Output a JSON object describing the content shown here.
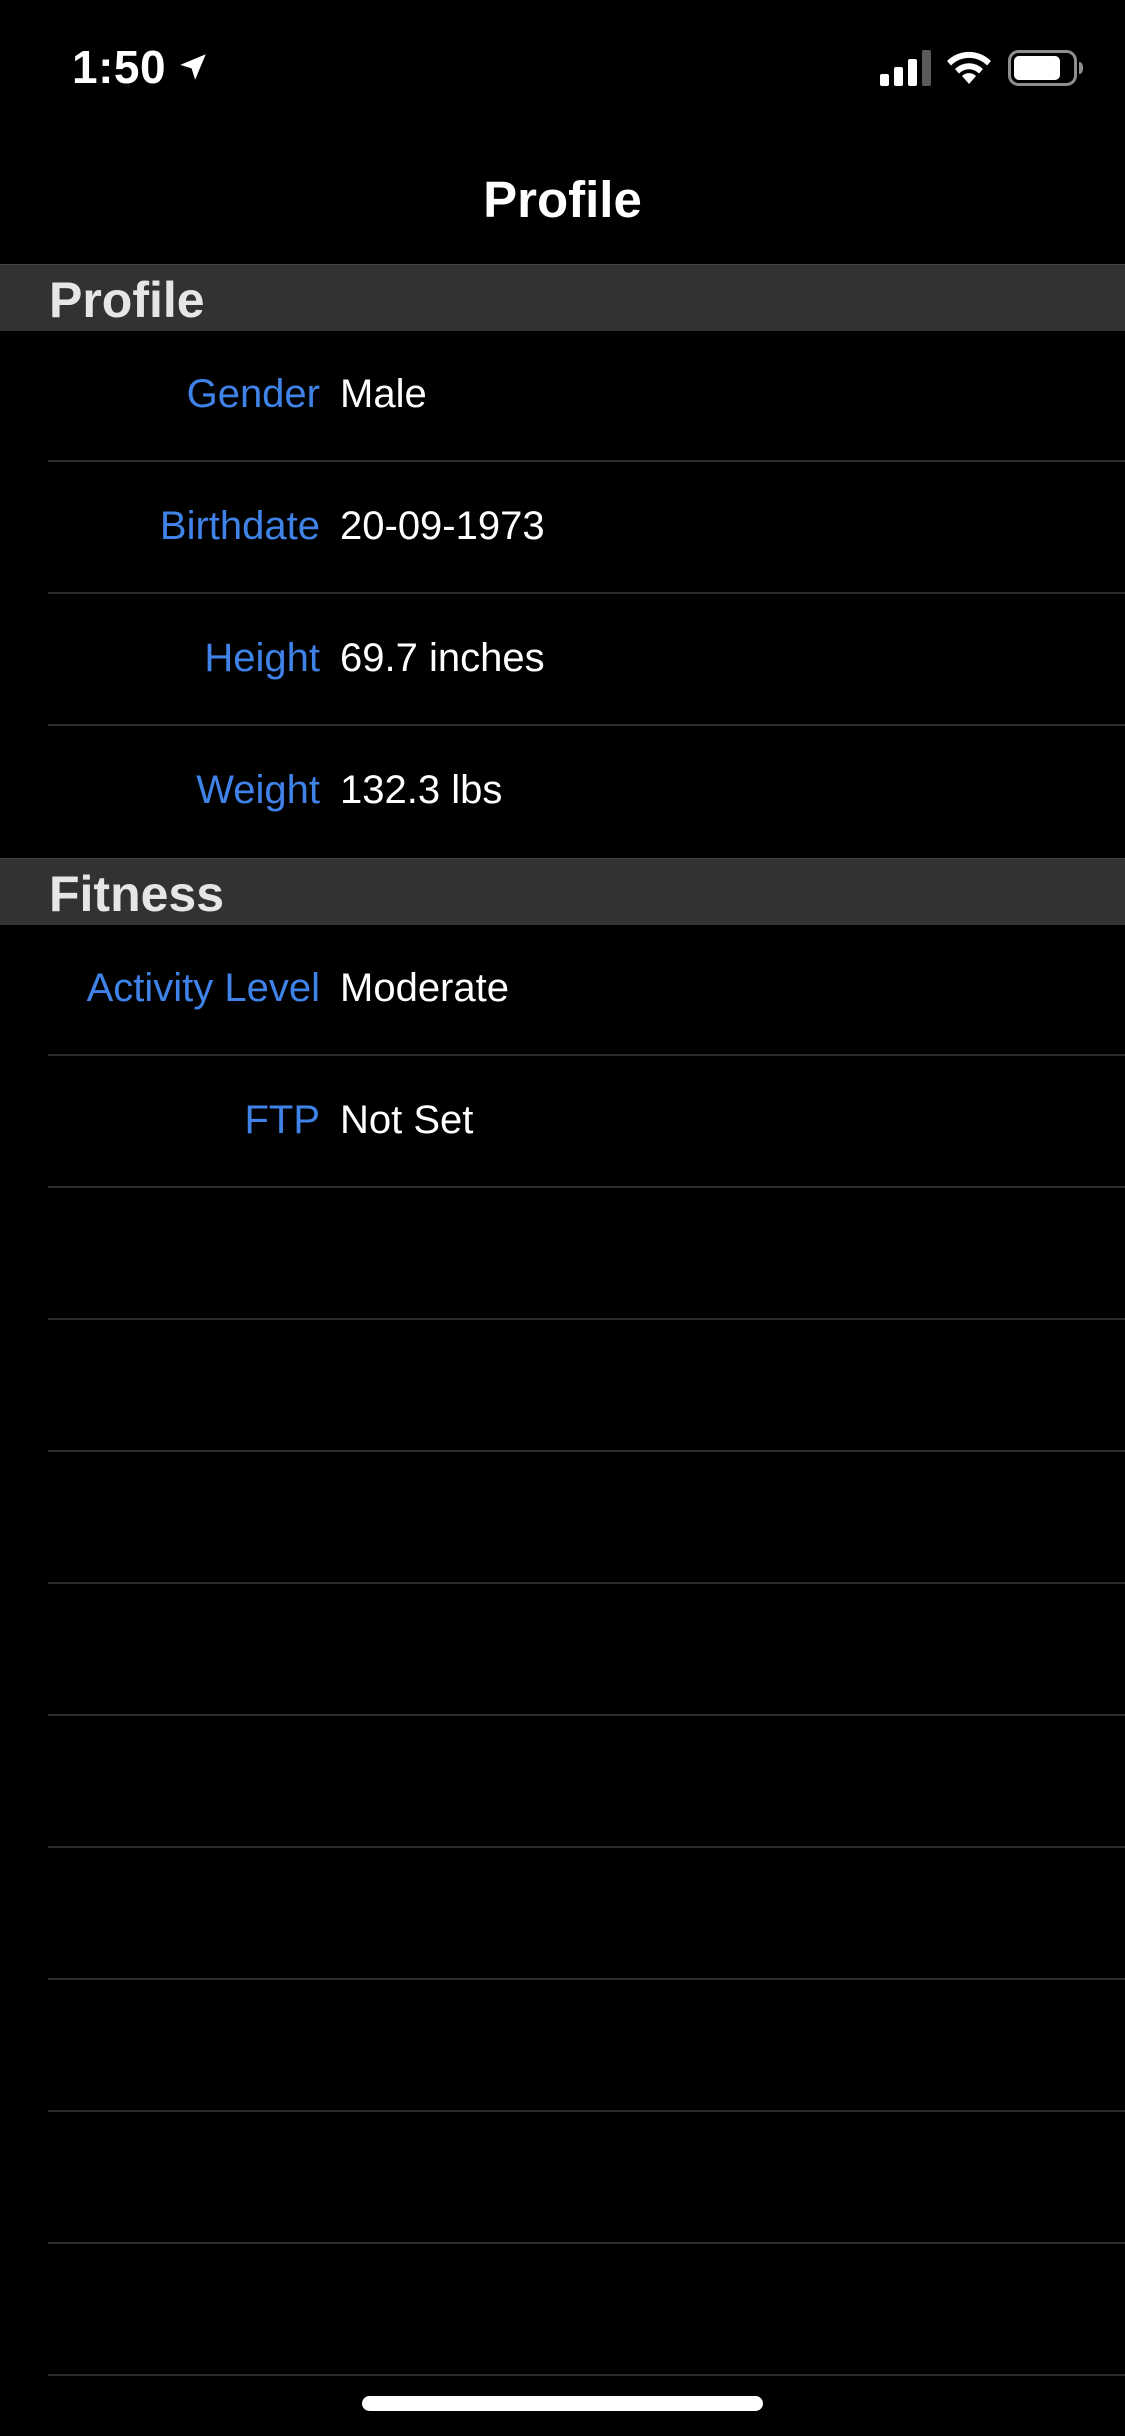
{
  "status_bar": {
    "time": "1:50",
    "icons": [
      "location-arrow-icon",
      "cellular-signal-icon",
      "wifi-icon",
      "battery-icon"
    ]
  },
  "nav": {
    "title": "Profile"
  },
  "sections": {
    "profile": {
      "title": "Profile",
      "rows": [
        {
          "label": "Gender",
          "value": "Male"
        },
        {
          "label": "Birthdate",
          "value": "20-09-1973"
        },
        {
          "label": "Height",
          "value": "69.7 inches"
        },
        {
          "label": "Weight",
          "value": "132.3 lbs"
        }
      ]
    },
    "fitness": {
      "title": "Fitness",
      "rows": [
        {
          "label": "Activity Level",
          "value": "Moderate"
        },
        {
          "label": "FTP",
          "value": "Not Set"
        }
      ]
    }
  },
  "colors": {
    "background": "#000000",
    "section_header": "#323232",
    "label_accent": "#3f82e8",
    "value_text": "#ffffff",
    "separator": "#2a2a2c"
  }
}
